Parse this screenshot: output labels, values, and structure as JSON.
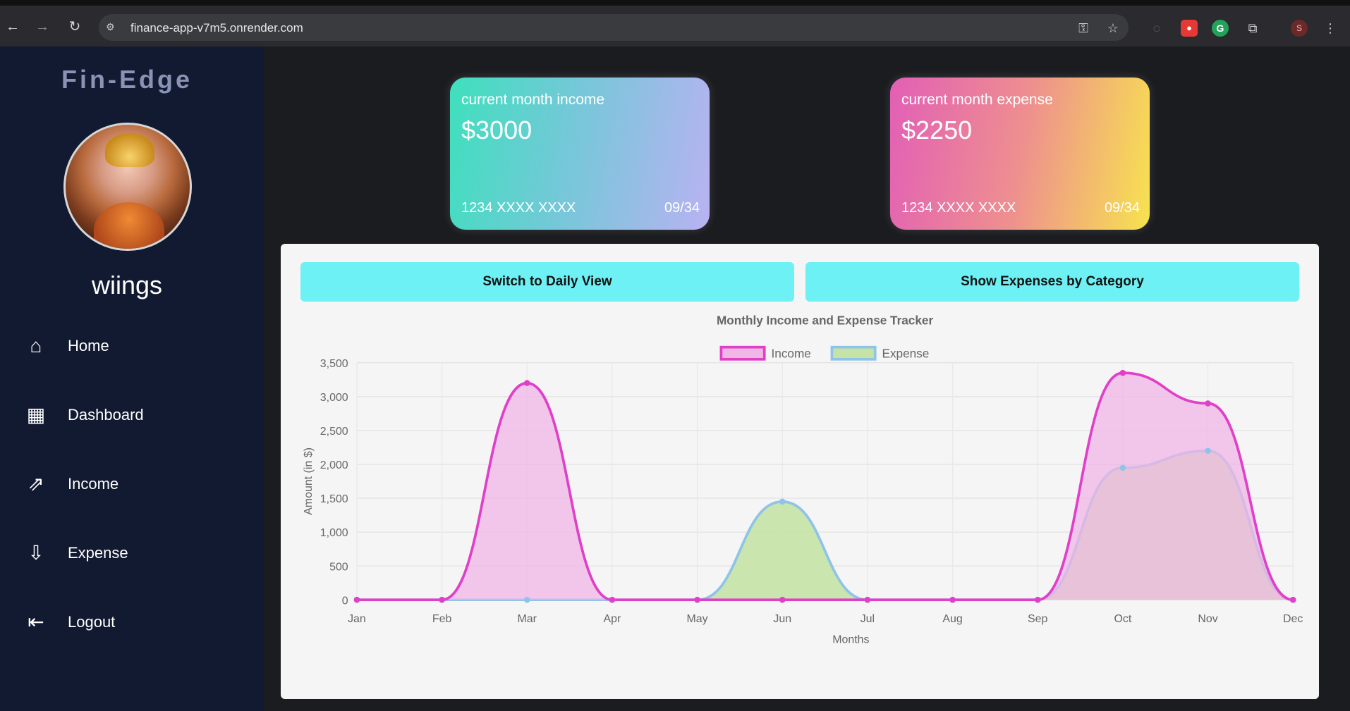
{
  "browser": {
    "url": "finance-app-v7m5.onrender.com",
    "back_icon": "arrow-left-icon",
    "forward_icon": "arrow-right-icon",
    "reload_icon": "reload-icon"
  },
  "sidebar": {
    "brand": "Fin-Edge",
    "username": "wiings",
    "items": [
      {
        "label": "Home",
        "icon": "home-icon"
      },
      {
        "label": "Dashboard",
        "icon": "dashboard-icon"
      },
      {
        "label": "Income",
        "icon": "income-icon"
      },
      {
        "label": "Expense",
        "icon": "expense-icon"
      },
      {
        "label": "Logout",
        "icon": "logout-icon"
      }
    ]
  },
  "cards": {
    "income": {
      "title": "current month income",
      "amount": "$3000",
      "number": "1234 XXXX XXXX",
      "expiry": "09/34"
    },
    "expense": {
      "title": "current month expense",
      "amount": "$2250",
      "number": "1234 XXXX XXXX",
      "expiry": "09/34"
    }
  },
  "actions": {
    "daily_label": "Switch to Daily View",
    "category_label": "Show Expenses by Category"
  },
  "chart_data": {
    "type": "area",
    "title": "Monthly Income and Expense Tracker",
    "xlabel": "Months",
    "ylabel": "Amount (in $)",
    "categories": [
      "Jan",
      "Feb",
      "Mar",
      "Apr",
      "May",
      "Jun",
      "Jul",
      "Aug",
      "Sep",
      "Oct",
      "Nov",
      "Dec"
    ],
    "ylim": [
      0,
      3500
    ],
    "yticks": [
      "0",
      "500",
      "1,000",
      "1,500",
      "2,000",
      "2,500",
      "3,000",
      "3,500"
    ],
    "series": [
      {
        "name": "Income",
        "values": [
          0,
          0,
          3200,
          0,
          0,
          0,
          0,
          0,
          0,
          3350,
          2900,
          0
        ],
        "color": "#e040c8",
        "fill": "#f0b6e6"
      },
      {
        "name": "Expense",
        "values": [
          0,
          0,
          0,
          0,
          0,
          1450,
          0,
          0,
          0,
          1950,
          2200,
          0
        ],
        "color": "#8ec4e8",
        "fill": "#c6e3a6"
      }
    ],
    "legend": "top",
    "grid": true
  }
}
